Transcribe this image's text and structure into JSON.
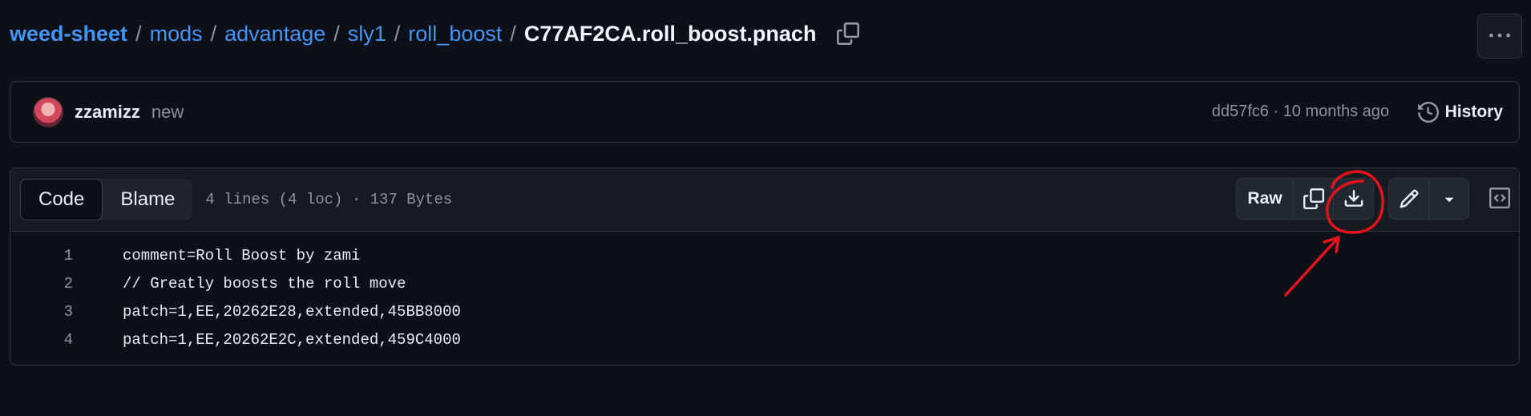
{
  "breadcrumb": {
    "repo": "weed-sheet",
    "path": [
      "mods",
      "advantage",
      "sly1",
      "roll_boost"
    ],
    "separator": "/",
    "file": "C77AF2CA.roll_boost.pnach"
  },
  "commit": {
    "author": "zzamizz",
    "message": "new",
    "meta": "dd57fc6 · 10 months ago",
    "history_label": "History"
  },
  "file_header": {
    "tabs": [
      {
        "label": "Code",
        "active": true
      },
      {
        "label": "Blame",
        "active": false
      }
    ],
    "info": "4 lines (4 loc) · 137 Bytes",
    "raw_label": "Raw"
  },
  "code": {
    "lines": [
      {
        "n": "1",
        "text": "comment=Roll Boost by zami"
      },
      {
        "n": "2",
        "text": "// Greatly boosts the roll move"
      },
      {
        "n": "3",
        "text": "patch=1,EE,20262E28,extended,45BB8000"
      },
      {
        "n": "4",
        "text": "patch=1,EE,20262E2C,extended,459C4000"
      }
    ]
  },
  "icons": [
    "copy-icon",
    "kebab-horizontal-icon",
    "history-icon",
    "download-icon",
    "pencil-icon",
    "triangle-down-icon",
    "code-square-icon"
  ],
  "colors": {
    "link": "#4493f8",
    "background": "#0d1117",
    "annotation": "#e3121b"
  }
}
